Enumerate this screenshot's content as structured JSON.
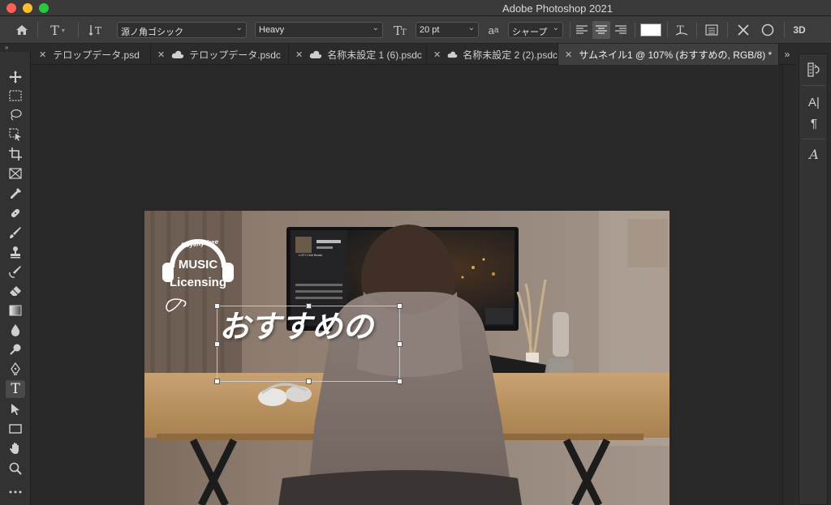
{
  "titlebar": {
    "app_title": "Adobe Photoshop 2021"
  },
  "options_bar": {
    "font_family": "源ノ角ゴシック",
    "font_style": "Heavy",
    "font_size": "20 pt",
    "anti_alias": "シャープ",
    "aa_label": "a",
    "aa_label_sub": "a",
    "threed_label": "3D",
    "text_color": "#ffffff"
  },
  "tabs": [
    {
      "label": "テロップデータ.psd",
      "cloud": false
    },
    {
      "label": "テロップデータ.psdc",
      "cloud": true
    },
    {
      "label": "名称未設定 1 (6).psdc",
      "cloud": true
    },
    {
      "label": "名称未設定 2 (2).psdc",
      "cloud": true
    },
    {
      "label": "サムネイル1 @ 107% (おすすめの, RGB/8) *",
      "cloud": false,
      "active": true
    }
  ],
  "tabs_more": "»",
  "left_toggle": "»",
  "canvas": {
    "logo_text_top": "Royalty-free",
    "logo_text_main": "MUSIC",
    "logo_text_sub": "Licensing",
    "headline": "おすすめの",
    "screen_title": "LOFI Chill Beats"
  },
  "right_panel": {
    "char_label": "A|",
    "para_label": "¶",
    "glyphs_label": "A"
  },
  "colors": {
    "accent_close": "#ff5f57",
    "accent_min": "#febc2e",
    "accent_max": "#28c840"
  }
}
